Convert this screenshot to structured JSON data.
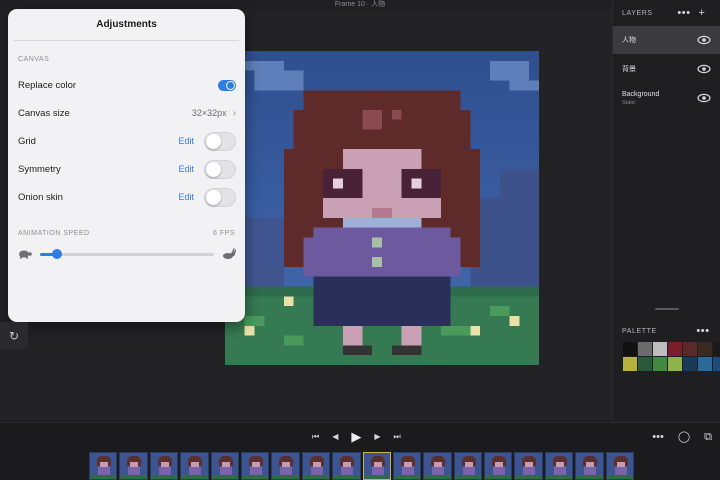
{
  "window": {
    "title": "Frame 10 · 人物"
  },
  "adjustments": {
    "title": "Adjustments",
    "canvas_section": "CANVAS",
    "replace_color": {
      "label": "Replace color",
      "on": true
    },
    "canvas_size": {
      "label": "Canvas size",
      "value": "32×32px"
    },
    "grid": {
      "label": "Grid",
      "edit": "Edit",
      "on": false
    },
    "symmetry": {
      "label": "Symmetry",
      "edit": "Edit",
      "on": false
    },
    "onion_skin": {
      "label": "Onion skin",
      "edit": "Edit",
      "on": false
    },
    "animation_speed": {
      "label": "ANIMATION SPEED",
      "value_label": "6 FPS",
      "fps": 6,
      "fraction": 0.1
    }
  },
  "layers": {
    "title": "LAYERS",
    "items": [
      {
        "name": "人物",
        "sub": "",
        "active": true
      },
      {
        "name": "背景",
        "sub": "",
        "active": false
      },
      {
        "name": "Background",
        "sub": "Static",
        "active": false
      }
    ]
  },
  "palette": {
    "title": "PALETTE",
    "colors": [
      "#111111",
      "#6b6b6b",
      "#bdbdbd",
      "#7a1f2a",
      "#5a2a2a",
      "#3a2a22",
      "#1a1a1a",
      "#b7b23a",
      "#2b5a3a",
      "#3f8a3f",
      "#8fb34a",
      "#1a3a5a",
      "#2a6a9a",
      "#1f4a7a"
    ]
  },
  "timeline": {
    "frame_count": 18,
    "active_frame": 10
  },
  "icons": {
    "more": "ellipsis-icon",
    "add": "plus-icon",
    "eye": "eye-icon",
    "turtle": "turtle-icon",
    "rabbit": "rabbit-icon",
    "undo": "redo-icon",
    "first": "skip-first-icon",
    "prev": "step-back-icon",
    "play": "play-icon",
    "next": "step-forward-icon",
    "last": "skip-last-icon",
    "onion": "onion-ring-icon",
    "duplicate": "duplicate-frame-icon"
  }
}
